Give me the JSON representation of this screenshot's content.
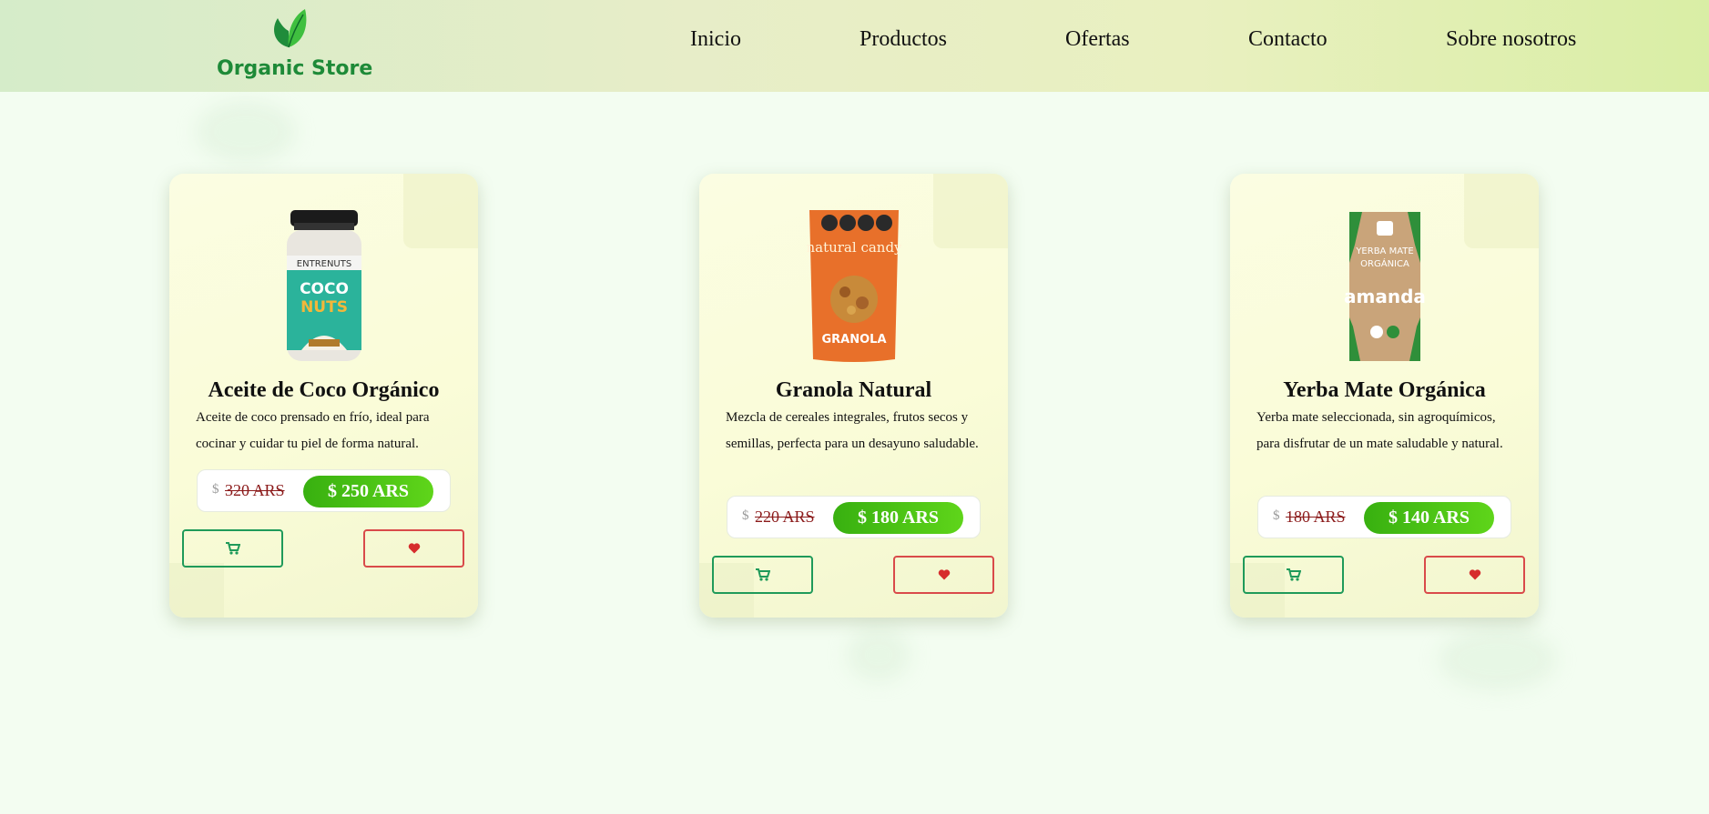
{
  "header": {
    "logo_text": "Organic Store",
    "nav": [
      "Inicio",
      "Productos",
      "Ofertas",
      "Contacto",
      "Sobre nosotros"
    ]
  },
  "colors": {
    "brand_green": "#1e8a38",
    "price_gradient_start": "#38b010",
    "price_gradient_end": "#5fd51a",
    "old_price": "#8b1a1a",
    "cart_border": "#1f9a5a",
    "fav_border": "#d94a4a"
  },
  "icons": {
    "logo": "leaf-icon",
    "cart": "cart-icon",
    "favorite": "heart-icon"
  },
  "products": [
    {
      "title": "Aceite de Coco Orgánico",
      "description": "Aceite de coco prensado en frío, ideal para cocinar y cuidar tu piel de forma natural.",
      "currency_symbol": "$",
      "old_price": "320 ARS",
      "new_price": "$ 250 ARS",
      "image": "coconut-oil-jar",
      "image_label_brand": "ENTRENUTS",
      "image_label_product": "COCO NUTS"
    },
    {
      "title": "Granola Natural",
      "description": "Mezcla de cereales integrales, frutos secos y semillas, perfecta para un desayuno saludable.",
      "currency_symbol": "$",
      "old_price": "220 ARS",
      "new_price": "$ 180 ARS",
      "image": "granola-bag",
      "image_label_brand": "natural candy",
      "image_label_product": "GRANOLA"
    },
    {
      "title": "Yerba Mate Orgánica",
      "description": "Yerba mate seleccionada, sin agroquímicos, para disfrutar de un mate saludable y natural.",
      "currency_symbol": "$",
      "old_price": "180 ARS",
      "new_price": "$ 140 ARS",
      "image": "yerba-mate-pack",
      "image_label_product": "YERBA MATE ORGÁNICA",
      "image_label_brand": "amanda"
    }
  ]
}
